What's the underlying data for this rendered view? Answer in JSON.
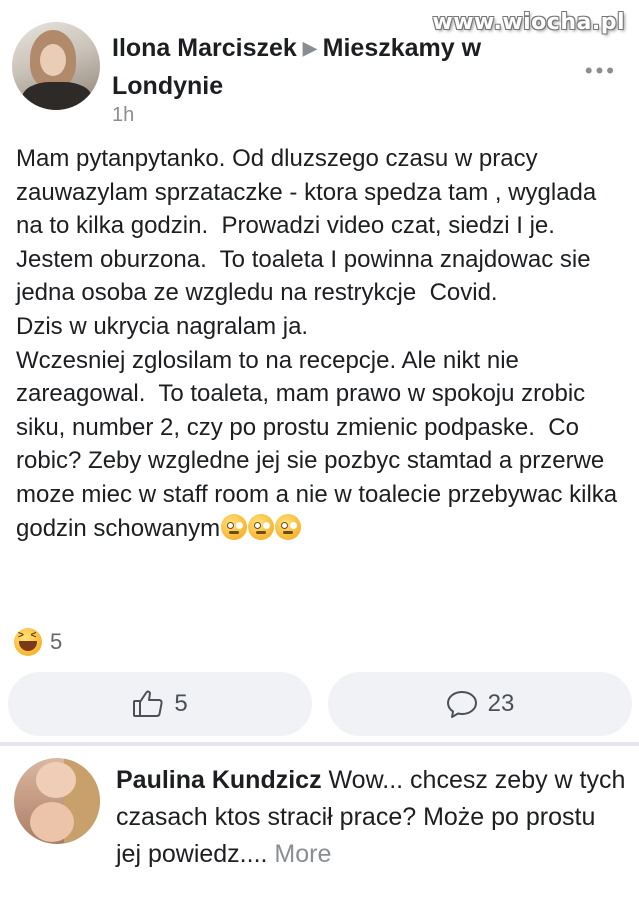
{
  "watermark": "www.wiocha.pl",
  "post": {
    "author": "Ilona Marciszek",
    "group": "Mieszkamy w Londynie",
    "time": "1h",
    "more_icon": "•••",
    "body": "Mam pytanpytanko. Od dluzszego czasu w pracy zauwazylam sprzataczke - ktora spedza tam , wyglada na to kilka godzin.  Prowadzi video czat, siedzi I je.  Jestem oburzona.  To toaleta I powinna znajdowac sie jedna osoba ze wzgledu na restrykcje  Covid.\nDzis w ukrycia nagralam ja.\nWczesniej zglosilam to na recepcje. Ale nikt nie zareagowal.  To toaleta, mam prawo w spokoju zrobic siku, number 2, czy po prostu zmienic podpaske.  Co robic? Zeby wzgledne jej sie pozbyc stamtad a przerwe moze miec w staff room a nie w toalecie przebywac kilka godzin schowanym",
    "body_emojis": [
      "face-with-rolling-eyes",
      "face-with-rolling-eyes",
      "face-with-rolling-eyes"
    ],
    "reaction_icon": "laughing-face-icon",
    "reaction_count": "5"
  },
  "actions": {
    "like_icon": "thumbs-up-icon",
    "like_count": "5",
    "comment_icon": "comment-bubble-icon",
    "comment_count": "23"
  },
  "comment": {
    "author": "Paulina Kundzicz",
    "text": " Wow... chcesz zeby w tych czasach ktos stracił prace? Może po prostu jej powiedz.... ",
    "more_label": "More"
  }
}
